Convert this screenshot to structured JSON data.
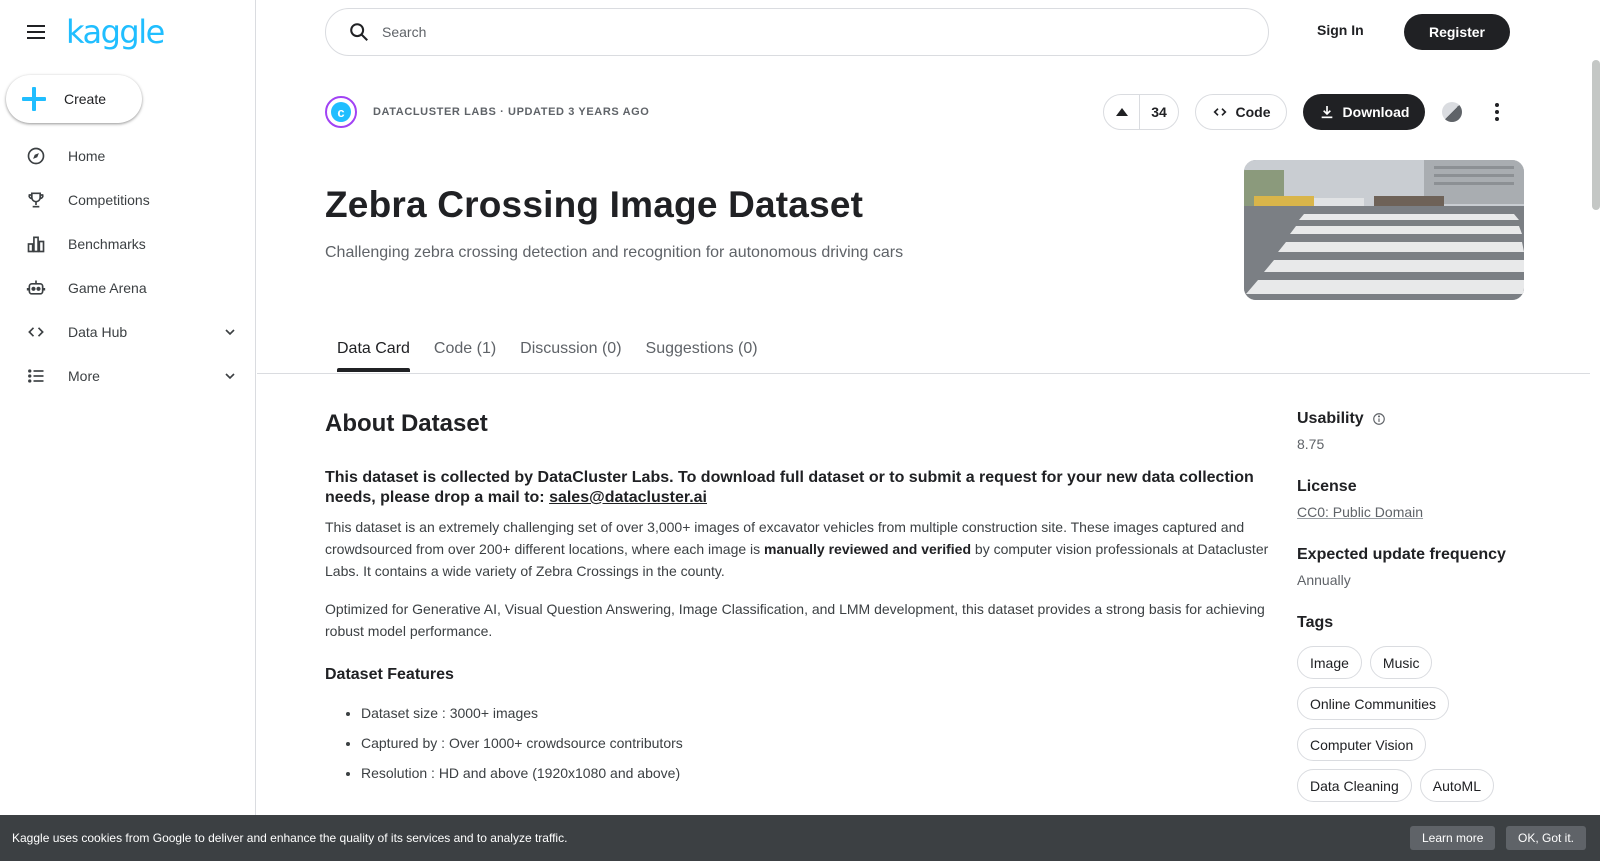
{
  "brand": {
    "logo_text": "kaggle",
    "accent": "#20beff"
  },
  "sidebar": {
    "create_label": "Create",
    "items": [
      {
        "label": "Home",
        "icon": "compass-icon"
      },
      {
        "label": "Competitions",
        "icon": "trophy-icon"
      },
      {
        "label": "Benchmarks",
        "icon": "bar-chart-icon"
      },
      {
        "label": "Game Arena",
        "icon": "robot-icon"
      },
      {
        "label": "Data Hub",
        "icon": "code-icon",
        "expandable": true
      },
      {
        "label": "More",
        "icon": "list-icon",
        "expandable": true
      }
    ]
  },
  "header": {
    "search_placeholder": "Search",
    "sign_in": "Sign In",
    "register": "Register"
  },
  "dataset": {
    "owner_line": "DATACLUSTER LABS · UPDATED 3 YEARS AGO",
    "owner_initial": "c",
    "votes": "34",
    "code_label": "Code",
    "download_label": "Download",
    "title": "Zebra Crossing Image Dataset",
    "subtitle": "Challenging zebra crossing detection and recognition for autonomous driving cars"
  },
  "tabs": [
    {
      "label": "Data Card",
      "active": true
    },
    {
      "label": "Code (1)",
      "active": false
    },
    {
      "label": "Discussion (0)",
      "active": false
    },
    {
      "label": "Suggestions (0)",
      "active": false
    }
  ],
  "about": {
    "heading": "About Dataset",
    "lead_text": "This dataset is collected by DataCluster Labs. To download full dataset or to submit a request for your new data collection needs, please drop a mail to: ",
    "lead_email": "sales@datacluster.ai",
    "para1_a": "This dataset is an extremely challenging set of over 3,000+ images of excavator vehicles from multiple construction site. These images captured and crowdsourced from over 200+ different locations, where each image is ",
    "para1_bold": "manually reviewed and verified",
    "para1_b": " by computer vision professionals at Datacluster Labs. It contains a wide variety of Zebra Crossings in the county.",
    "para2": "Optimized for Generative AI, Visual Question Answering, Image Classification, and LMM development, this dataset provides a strong basis for achieving robust model performance.",
    "features_heading": "Dataset Features",
    "features": [
      "Dataset size : 3000+ images",
      "Captured by : Over 1000+ crowdsource contributors",
      "Resolution : HD and above (1920x1080 and above)"
    ]
  },
  "side": {
    "usability_label": "Usability",
    "usability_value": "8.75",
    "license_label": "License",
    "license_value": "CC0: Public Domain",
    "frequency_label": "Expected update frequency",
    "frequency_value": "Annually",
    "tags_label": "Tags",
    "tags": [
      "Image",
      "Music",
      "Online Communities",
      "Computer Vision",
      "Data Cleaning",
      "AutoML"
    ]
  },
  "cookie": {
    "message": "Kaggle uses cookies from Google to deliver and enhance the quality of its services and to analyze traffic.",
    "learn_more": "Learn more",
    "ok": "OK, Got it."
  }
}
